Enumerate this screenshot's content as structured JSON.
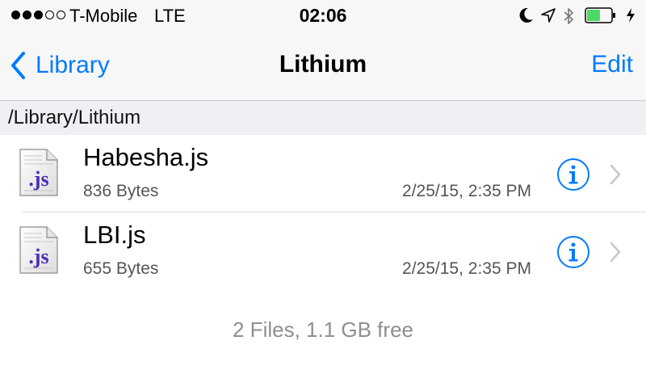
{
  "status_bar": {
    "signal_bars_filled": 3,
    "signal_bars_total": 5,
    "carrier": "T-Mobile",
    "network": "LTE",
    "time": "02:06",
    "icons": [
      "moon-icon",
      "location-arrow-icon",
      "bluetooth-icon",
      "battery-icon",
      "charging-bolt-icon"
    ],
    "battery_level": 0.55,
    "battery_color": "#4cd964"
  },
  "nav": {
    "back_label": "Library",
    "title": "Lithium",
    "edit_label": "Edit",
    "accent_color": "#007aff"
  },
  "path": "/Library/Lithium",
  "files": [
    {
      "name": "Habesha.js",
      "size": "836 Bytes",
      "date": "2/25/15, 2:35 PM",
      "icon": "js-file-icon"
    },
    {
      "name": "LBI.js",
      "size": "655 Bytes",
      "date": "2/25/15, 2:35 PM",
      "icon": "js-file-icon"
    }
  ],
  "footer": "2 Files, 1.1 GB free"
}
